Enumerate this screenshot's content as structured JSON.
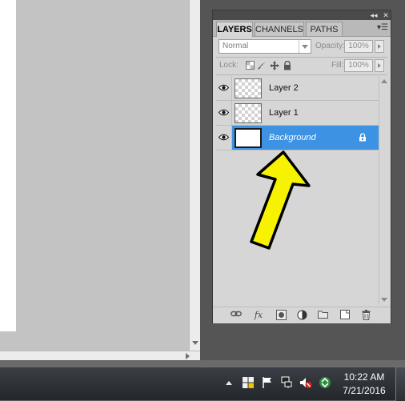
{
  "panel": {
    "tabs": [
      {
        "label": "LAYERS",
        "active": true
      },
      {
        "label": "CHANNELS",
        "active": false
      },
      {
        "label": "PATHS",
        "active": false
      }
    ],
    "blend_mode": "Normal",
    "opacity_label": "Opacity:",
    "opacity_value": "100%",
    "lock_label": "Lock:",
    "fill_label": "Fill:",
    "fill_value": "100%",
    "layers": [
      {
        "name": "Layer 2",
        "visible": true,
        "selected": false,
        "locked": false
      },
      {
        "name": "Layer 1",
        "visible": true,
        "selected": false,
        "locked": false
      },
      {
        "name": "Background",
        "visible": true,
        "selected": true,
        "locked": true
      }
    ],
    "bottom_icons": [
      "link-layers-icon",
      "fx-icon",
      "layer-mask-icon",
      "adjustment-layer-icon",
      "group-folder-icon",
      "new-layer-icon",
      "trash-icon"
    ],
    "fx_text": "fx"
  },
  "annotation": {
    "color": "#f7f300",
    "outline": "#000000"
  },
  "colors": {
    "selection": "#3d92e3",
    "panel_bg": "#d6d6d6",
    "canvas_bg": "#c3c3c3"
  },
  "taskbar": {
    "time": "10:22 AM",
    "date": "7/21/2016",
    "tray_icons": [
      "windows-flag-icon",
      "action-center-flag-icon",
      "network-icon",
      "volume-muted-icon",
      "recycle-icon"
    ]
  }
}
